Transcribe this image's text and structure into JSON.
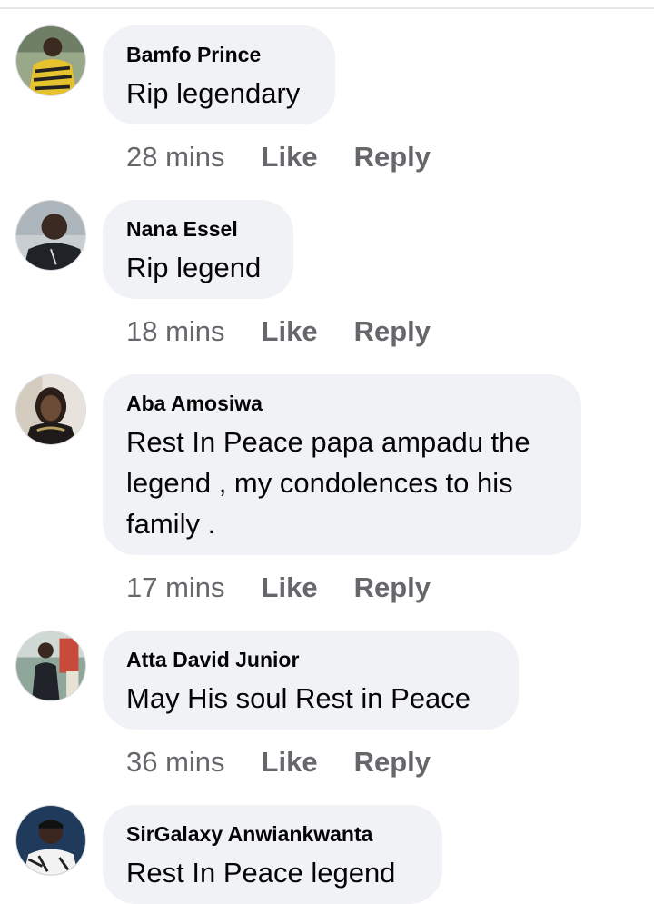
{
  "comments": [
    {
      "author": "Bamfo Prince",
      "text": "Rip legendary",
      "time": "28 mins",
      "like_label": "Like",
      "reply_label": "Reply"
    },
    {
      "author": "Nana Essel",
      "text": "Rip legend",
      "time": "18 mins",
      "like_label": "Like",
      "reply_label": "Reply"
    },
    {
      "author": "Aba Amosiwa",
      "text": "Rest In Peace papa ampadu the legend , my condolences to his family .",
      "time": "17 mins",
      "like_label": "Like",
      "reply_label": "Reply"
    },
    {
      "author": "Atta David Junior",
      "text": "May His soul Rest in Peace",
      "time": "36 mins",
      "like_label": "Like",
      "reply_label": "Reply"
    },
    {
      "author": "SirGalaxy Anwiankwanta",
      "text": "Rest In Peace legend",
      "time": "",
      "like_label": "",
      "reply_label": ""
    }
  ],
  "colors": {
    "bubble": "#f0f2f5",
    "text": "#050505",
    "secondary": "#65676b"
  }
}
